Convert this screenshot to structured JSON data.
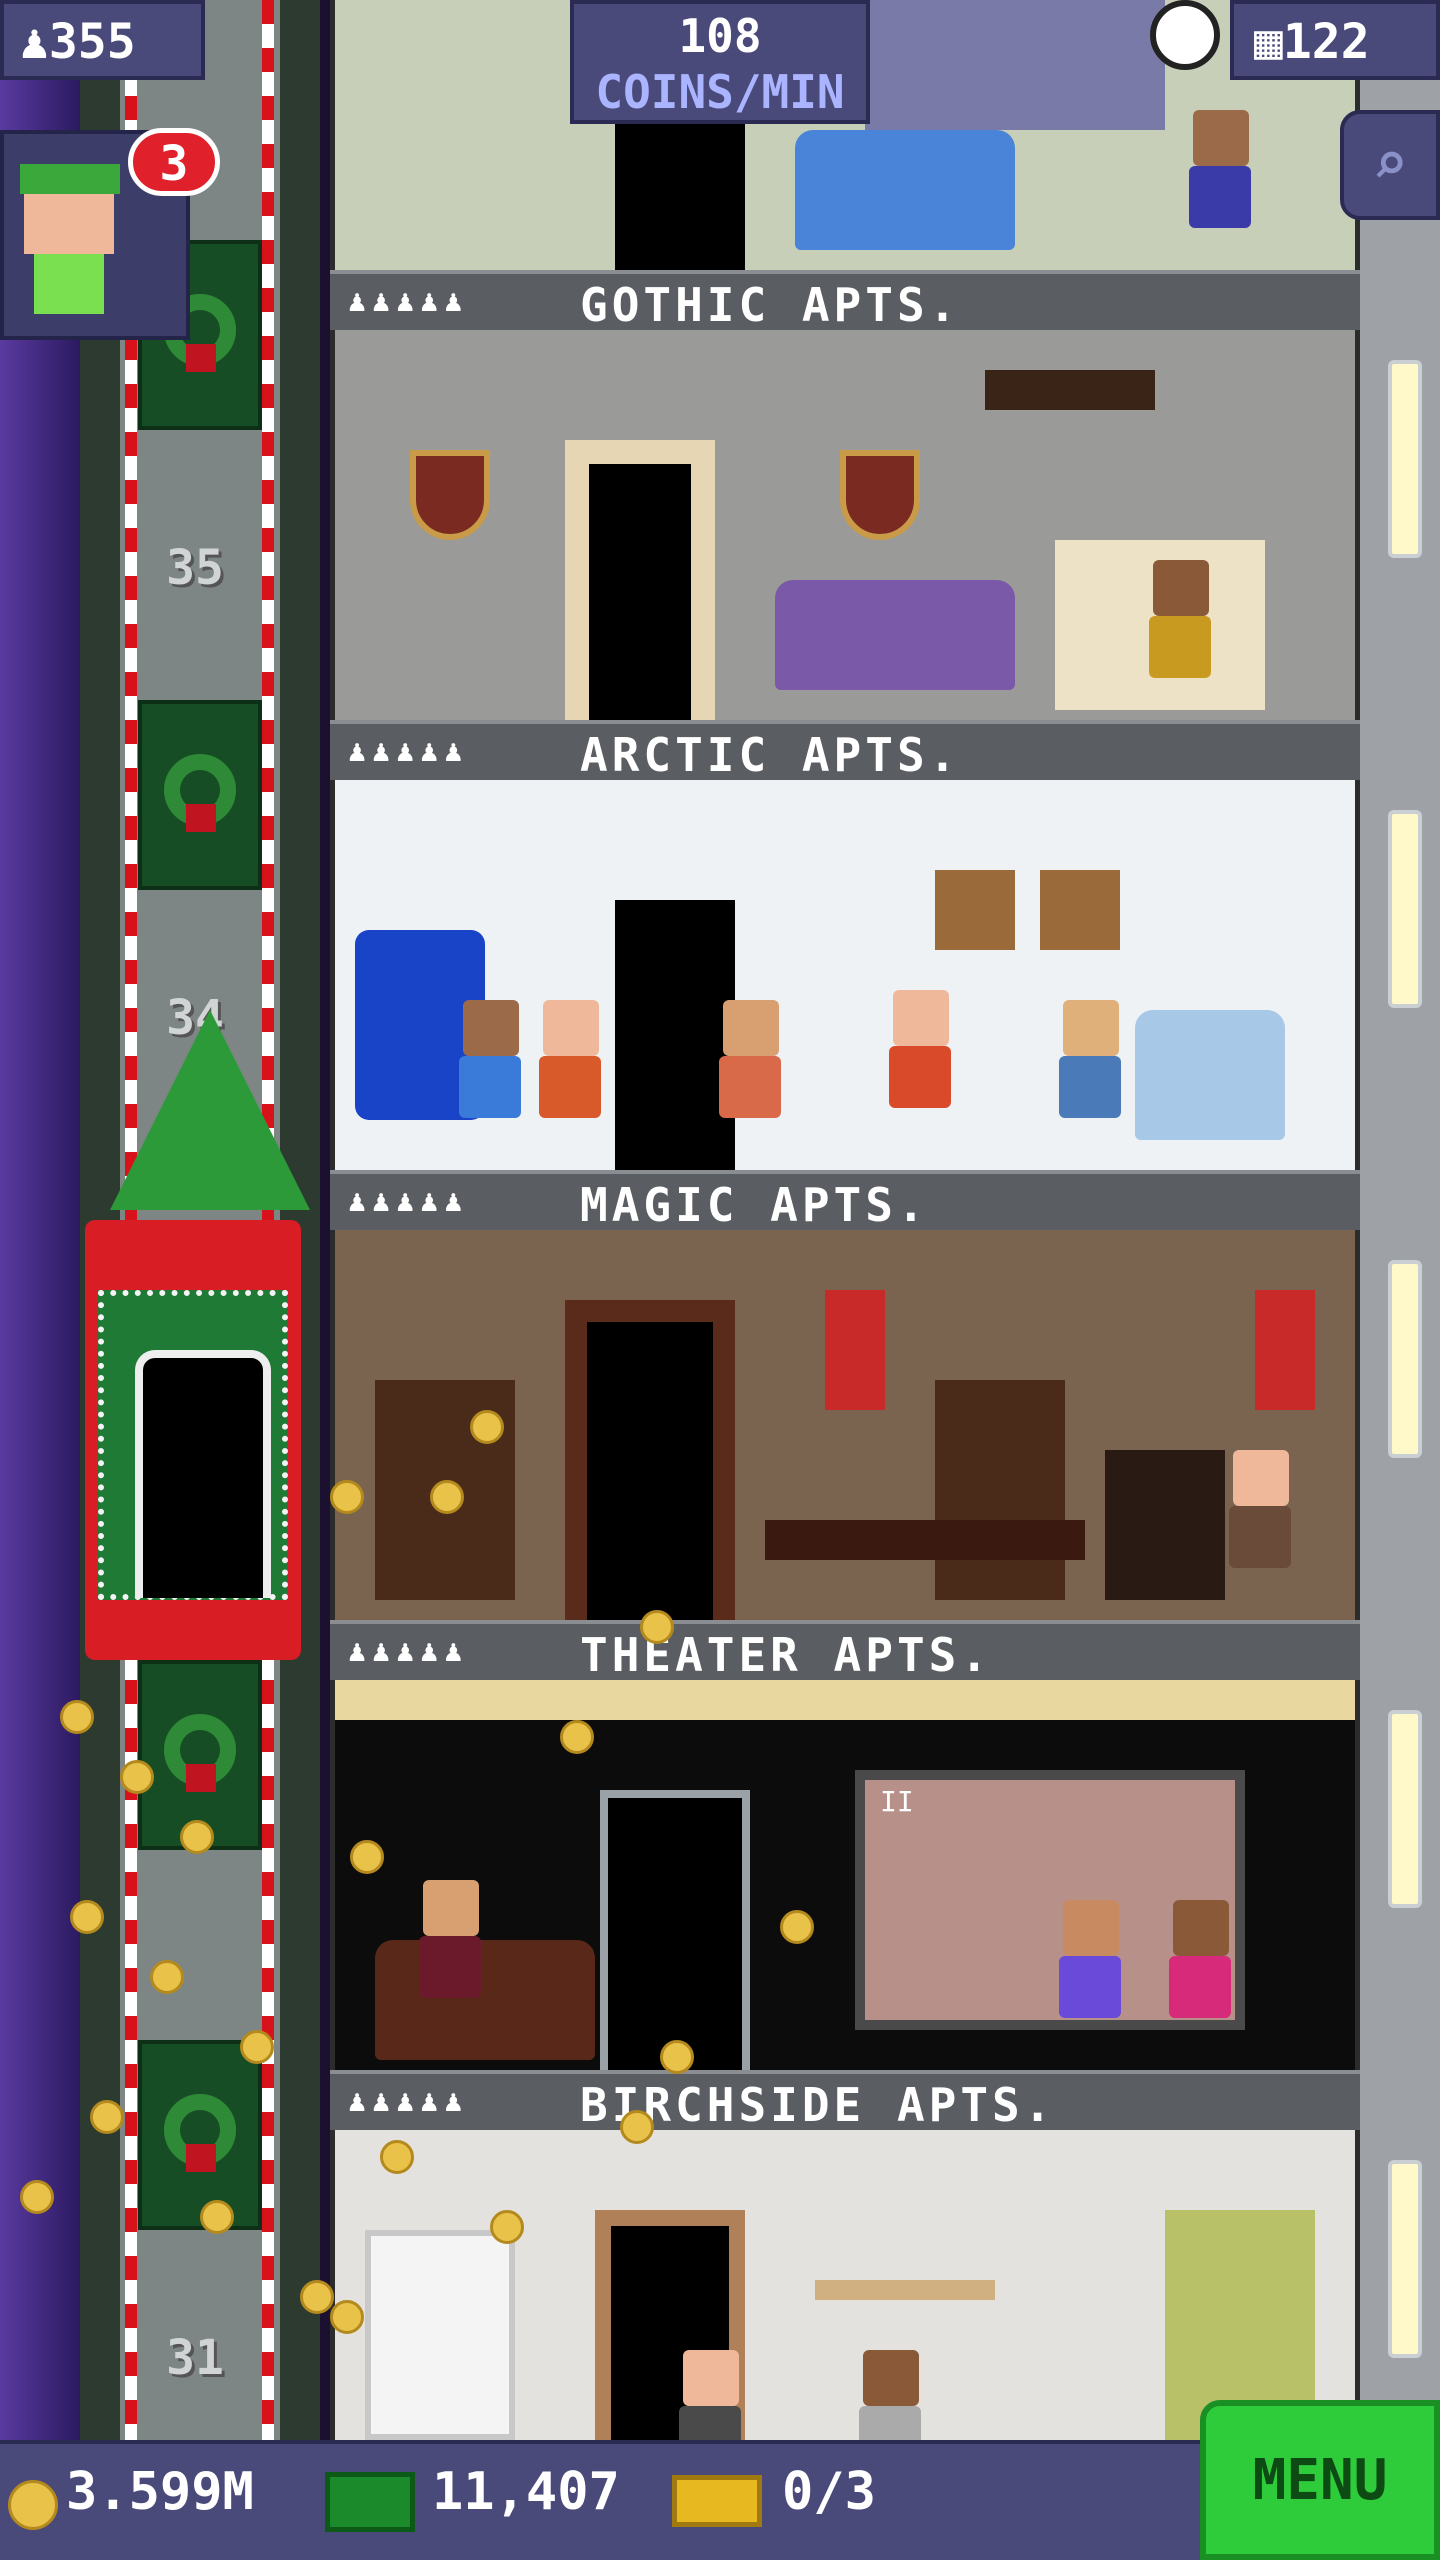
{
  "hud": {
    "population": "355",
    "coins_per_min_value": "108",
    "coins_per_min_unit": "COINS/MIN",
    "floor_count": "122",
    "notification_count": "3"
  },
  "floors": [
    {
      "name": "GOTHIC APTS.",
      "residents": "♟♟♟♟♟"
    },
    {
      "name": "ARCTIC APTS.",
      "residents": "♟♟♟♟♟"
    },
    {
      "name": "MAGIC APTS.",
      "residents": "♟♟♟♟♟"
    },
    {
      "name": "THEATER APTS.",
      "residents": "♟♟♟♟♟"
    },
    {
      "name": "BIRCHSIDE APTS.",
      "residents": "♟♟♟♟♟"
    }
  ],
  "shaft": {
    "labels": [
      "35",
      "34",
      "31"
    ]
  },
  "bottom": {
    "coins": "3.599M",
    "bux": "11,407",
    "tickets": "0/3",
    "menu_label": "MENU"
  },
  "colors": {
    "hud_bg": "#4a4a7a",
    "menu_green": "#2ecc3a",
    "coin_gold": "#e9c24a"
  }
}
